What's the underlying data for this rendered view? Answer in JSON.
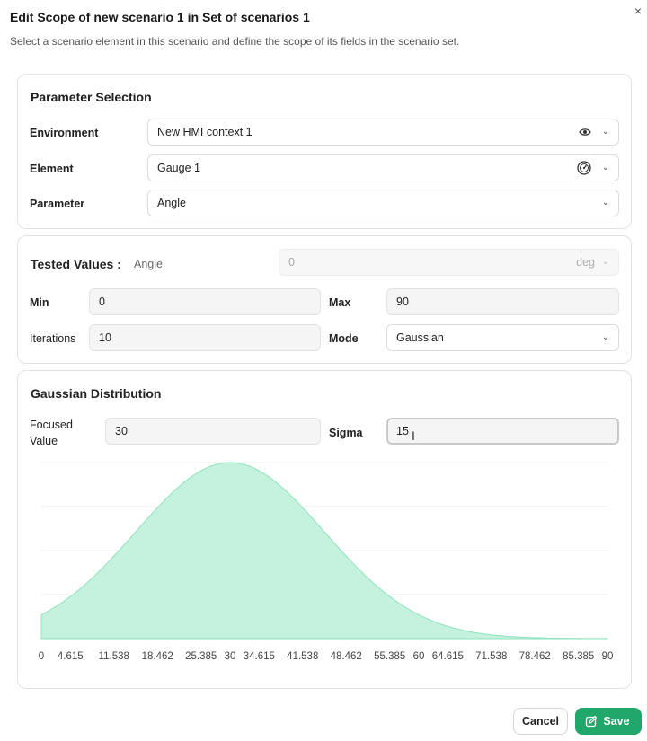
{
  "dialog": {
    "title": "Edit Scope of new scenario 1 in Set of scenarios 1",
    "subtitle": "Select a scenario element in this scenario and define the scope of its fields in the scenario set.",
    "close_icon": "×"
  },
  "parameter_selection": {
    "title": "Parameter Selection",
    "environment_label": "Environment",
    "environment_value": "New HMI context 1",
    "element_label": "Element",
    "element_value": "Gauge 1",
    "parameter_label": "Parameter",
    "parameter_value": "Angle"
  },
  "tested_values": {
    "title": "Tested Values :",
    "parameter_name": "Angle",
    "value": "0",
    "unit": "deg",
    "min_label": "Min",
    "min_value": "0",
    "max_label": "Max",
    "max_value": "90",
    "iterations_label": "Iterations",
    "iterations_value": "10",
    "mode_label": "Mode",
    "mode_value": "Gaussian"
  },
  "gaussian": {
    "title": "Gaussian Distribution",
    "focused_label_line1": "Focused",
    "focused_label_line2": "Value",
    "focused_value": "30",
    "sigma_label": "Sigma",
    "sigma_value": "15"
  },
  "chart_data": {
    "type": "area",
    "distribution": "gaussian",
    "mean": 30,
    "sigma": 15,
    "xlim": [
      0,
      90
    ],
    "x_tick_labels": [
      "0",
      "4.615",
      "11.538",
      "18.462",
      "25.385",
      "30",
      "34.615",
      "41.538",
      "48.462",
      "55.385",
      "60",
      "64.615",
      "71.538",
      "78.462",
      "85.385",
      "90"
    ],
    "x_tick_values": [
      0,
      4.615,
      11.538,
      18.462,
      25.385,
      30,
      34.615,
      41.538,
      48.462,
      55.385,
      60,
      64.615,
      71.538,
      78.462,
      85.385,
      90
    ],
    "fill_color": "#c4f2dd",
    "stroke_color": "#8ee3bc",
    "grid": true
  },
  "footer": {
    "cancel_label": "Cancel",
    "save_label": "Save"
  },
  "colors": {
    "accent": "#1fa86a"
  }
}
